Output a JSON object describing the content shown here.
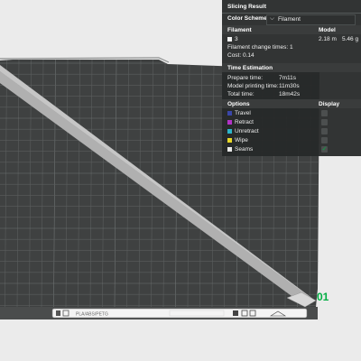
{
  "panel": {
    "title": "Slicing Result",
    "color_scheme_label": "Color Scheme",
    "color_scheme_value": "Filament",
    "col_filament": "Filament",
    "col_model": "Model",
    "filament_index": "3",
    "filament_length": "2.18 m",
    "filament_weight": "5.46 g",
    "filament_change_times": "Filament change times:  1",
    "cost": "Cost:  0.14",
    "time_section": "Time Estimation",
    "prepare_label": "Prepare time:",
    "prepare_value": "7m11s",
    "model_print_label": "Model printing time:",
    "model_print_value": "11m30s",
    "total_label": "Total time:",
    "total_value": "18m42s",
    "options_label": "Options",
    "display_label": "Display",
    "options": [
      {
        "label": "Travel",
        "color": "#3a46a8",
        "checked": false
      },
      {
        "label": "Retract",
        "color": "#b233c7",
        "checked": false
      },
      {
        "label": "Unretract",
        "color": "#2db5c9",
        "checked": false
      },
      {
        "label": "Wipe",
        "color": "#e8d827",
        "checked": false
      },
      {
        "label": "Seams",
        "color": "#e8e8e8",
        "checked": true
      }
    ]
  },
  "plate": {
    "number": "01",
    "label": "PLA/ABS/PETG"
  },
  "colors": {
    "plate": "#3f4141",
    "grid": "#5b5e5e",
    "accent": "#00ae42",
    "model": "#b5b5b5"
  }
}
